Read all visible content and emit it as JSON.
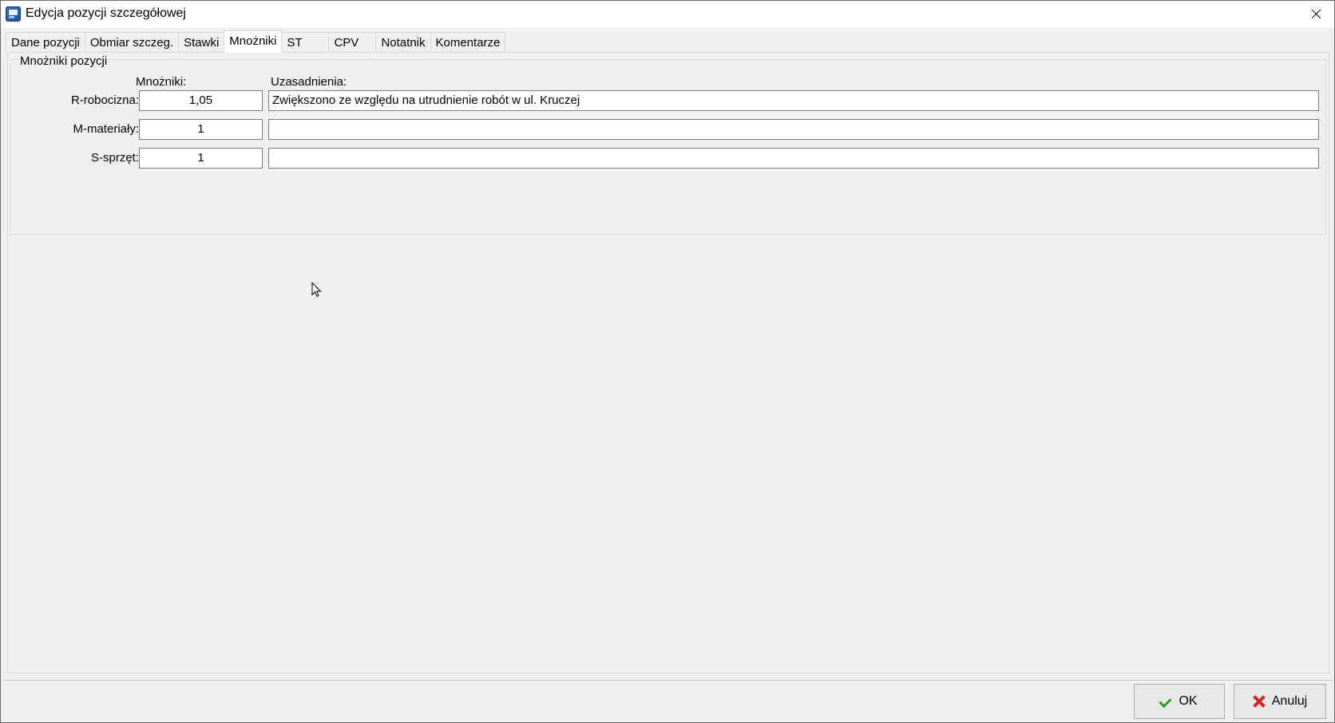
{
  "window": {
    "title": "Edycja pozycji szczegółowej"
  },
  "tabs": [
    {
      "label": "Dane pozycji",
      "active": false
    },
    {
      "label": "Obmiar szczeg.",
      "active": false
    },
    {
      "label": "Stawki",
      "active": false
    },
    {
      "label": "Mnożniki",
      "active": true
    },
    {
      "label": "ST",
      "active": false
    },
    {
      "label": "CPV",
      "active": false
    },
    {
      "label": "Notatnik",
      "active": false
    },
    {
      "label": "Komentarze",
      "active": false
    }
  ],
  "multipliers": {
    "group_title": "Mnożniki pozycji",
    "col_multiplier": "Mnożniki:",
    "col_justification": "Uzasadnienia:",
    "rows": [
      {
        "label": "R-robocizna:",
        "value": "1,05",
        "justification": "Zwiększono ze względu na utrudnienie robót w ul. Kruczej"
      },
      {
        "label": "M-materiały:",
        "value": "1",
        "justification": ""
      },
      {
        "label": "S-sprzęt:",
        "value": "1",
        "justification": ""
      }
    ]
  },
  "footer": {
    "ok_label": "OK",
    "cancel_label": "Anuluj"
  },
  "colors": {
    "ok_icon": "#2e9e2e",
    "cancel_icon": "#d81f1f",
    "window_bg": "#f0f0f0"
  },
  "icons": {
    "app": "app-icon",
    "close": "close-icon",
    "ok": "check-icon",
    "cancel": "x-icon"
  }
}
